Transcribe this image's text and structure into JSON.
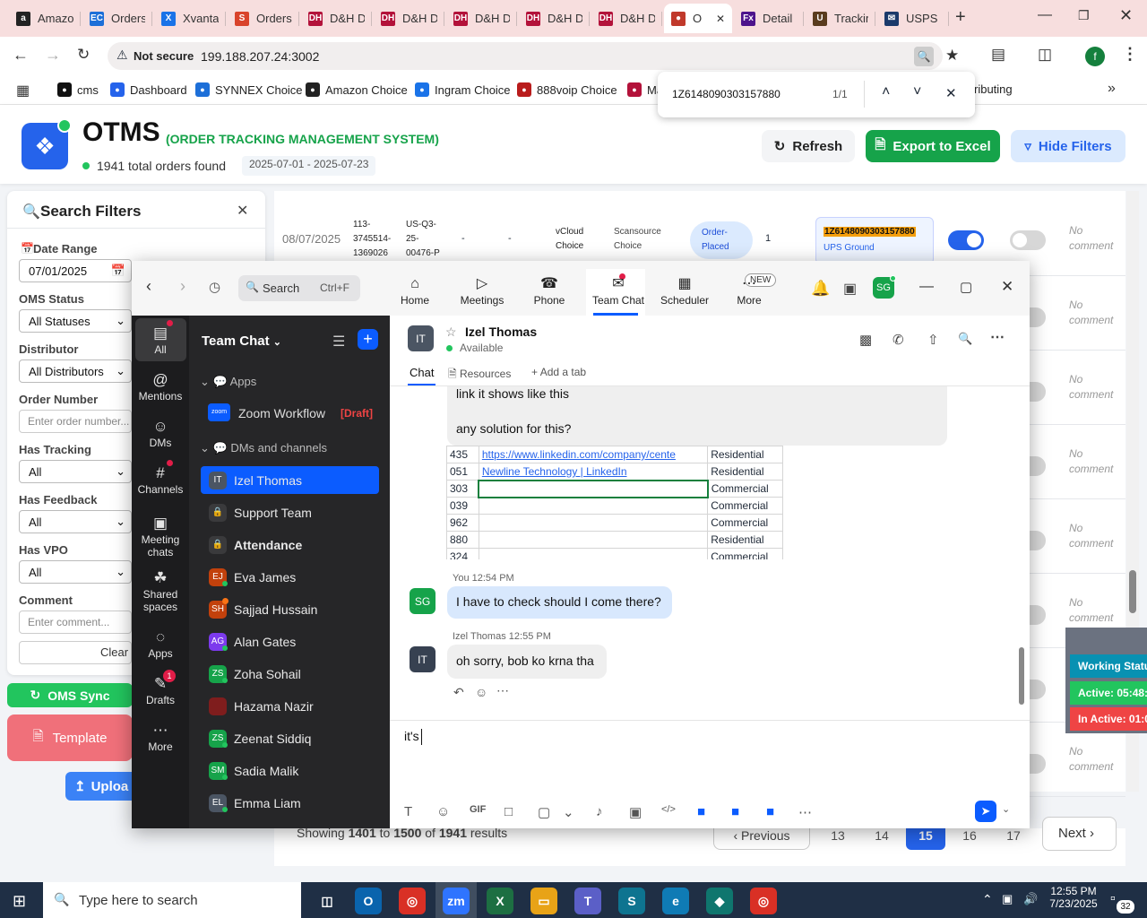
{
  "browser": {
    "tabs": [
      {
        "label": "Amazon",
        "color": "#222222",
        "glyph": "a"
      },
      {
        "label": "Orders",
        "color": "#1d6fd8",
        "glyph": "EC"
      },
      {
        "label": "Xvantage",
        "color": "#1a73e8",
        "glyph": "X"
      },
      {
        "label": "Orders",
        "color": "#d9432b",
        "glyph": "S"
      },
      {
        "label": "D&H Distributing",
        "color": "#b3123a",
        "glyph": "DH"
      },
      {
        "label": "D&H Distributing",
        "color": "#b3123a",
        "glyph": "DH"
      },
      {
        "label": "D&H Distributing",
        "color": "#b3123a",
        "glyph": "DH"
      },
      {
        "label": "D&H Distributing",
        "color": "#b3123a",
        "glyph": "DH"
      },
      {
        "label": "D&H Distributing",
        "color": "#b3123a",
        "glyph": "DH"
      },
      {
        "label": "O",
        "color": "#c0392b",
        "glyph": "●",
        "active": true
      },
      {
        "label": "Detail",
        "color": "#4d148c",
        "glyph": "Fx"
      },
      {
        "label": "Tracking",
        "color": "#5a3c1e",
        "glyph": "U"
      },
      {
        "label": "USPS",
        "color": "#1b3a6b",
        "glyph": "✉"
      }
    ],
    "url_warning": "Not secure",
    "url": "199.188.207.24:3002",
    "avatar_initial": "f",
    "bookmarks": [
      "cms",
      "Dashboard",
      "SYNNEX Choice",
      "Amazon Choice",
      "Ingram Choice",
      "888voip Choice",
      "Ma"
    ],
    "bookmark_overflow": "ributing",
    "find": {
      "query": "1Z6148090303157880",
      "count": "1/1"
    }
  },
  "app": {
    "title": "OTMS",
    "subtitle": "(ORDER TRACKING MANAGEMENT SYSTEM)",
    "orders_found": "1941 total orders found",
    "date_range": "2025-07-01 - 2025-07-23",
    "refresh": "Refresh",
    "export": "Export to Excel",
    "hide_filters": "Hide Filters"
  },
  "filters": {
    "title": "Search Filters",
    "date_label": "Date Range",
    "date_value": "07/01/2025",
    "oms_status_label": "OMS Status",
    "oms_status_value": "All Statuses",
    "distributor_label": "Distributor",
    "distributor_value": "All Distributors",
    "order_number_label": "Order Number",
    "order_number_placeholder": "Enter order number...",
    "has_tracking_label": "Has Tracking",
    "has_tracking_value": "All",
    "has_feedback_label": "Has Feedback",
    "has_feedback_value": "All",
    "has_vpo_label": "Has VPO",
    "has_vpo_value": "All",
    "comment_label": "Comment",
    "comment_placeholder": "Enter comment...",
    "clear": "Clear A",
    "oms_sync": "OMS Sync",
    "template": "Template",
    "upload": "Uploa"
  },
  "orders": {
    "row1": {
      "date": "08/07/2025",
      "order_no": [
        "113-",
        "3745514-",
        "1369026"
      ],
      "po": [
        "US-Q3-",
        "25-",
        "00476-P"
      ],
      "dash1": "-",
      "dash2": "-",
      "source": [
        "vCloud",
        "Choice"
      ],
      "distributor": [
        "Scansource",
        "Choice"
      ],
      "status": [
        "Order-",
        "Placed"
      ],
      "qty": "1",
      "tracking": "1Z6148090303157880",
      "carrier": "UPS Ground"
    },
    "no_comment": [
      "No",
      "comment"
    ],
    "pagination": {
      "showing": "Showing",
      "from": "1401",
      "to_word": "to",
      "to": "1500",
      "of_word": "of",
      "total": "1941",
      "results": "results",
      "previous": "Previous",
      "pages": [
        "13",
        "14",
        "15",
        "16",
        "17"
      ],
      "current": "15",
      "next": "Next"
    },
    "working_status": {
      "title": "Working Statu",
      "active": "Active: 05:48:",
      "inactive": "In Active: 01:0"
    }
  },
  "zoom": {
    "search_placeholder": "Search",
    "search_shortcut": "Ctrl+F",
    "nav": [
      "Home",
      "Meetings",
      "Phone",
      "Team Chat",
      "Scheduler",
      "More"
    ],
    "new_badge": "NEW",
    "user_initials": "SG",
    "rail": [
      "All",
      "Mentions",
      "DMs",
      "Channels",
      "Meeting chats",
      "Shared spaces",
      "Apps",
      "Drafts",
      "More"
    ],
    "drafts_badge": "1",
    "list_title": "Team Chat",
    "apps_section": "Apps",
    "zoom_workflow": "Zoom Workflow",
    "draft_tag": "[Draft]",
    "dms_section": "DMs and channels",
    "channels": [
      {
        "name": "Izel Thomas",
        "initials": "IT",
        "color": "#4b5563",
        "selected": true
      },
      {
        "name": "Support Team",
        "initials": "🔒",
        "color": "#3a3a3c"
      },
      {
        "name": "Attendance",
        "initials": "🔒",
        "color": "#3a3a3c",
        "bold": true
      },
      {
        "name": "Eva James",
        "initials": "EJ",
        "color": "#c2410c"
      },
      {
        "name": "Sajjad Hussain",
        "initials": "SH",
        "color": "#c2410c"
      },
      {
        "name": "Alan Gates",
        "initials": "AG",
        "color": "#7c3aed"
      },
      {
        "name": "Zoha Sohail",
        "initials": "ZS",
        "color": "#16a34a"
      },
      {
        "name": "Hazama Nazir",
        "initials": "",
        "color": "#7f1d1d"
      },
      {
        "name": "Zeenat Siddiq",
        "initials": "ZS",
        "color": "#16a34a"
      },
      {
        "name": "Sadia Malik",
        "initials": "SM",
        "color": "#16a34a"
      },
      {
        "name": "Emma Liam",
        "initials": "EL",
        "color": "#4b5563"
      }
    ],
    "chat": {
      "contact_name": "Izel Thomas",
      "contact_initials": "IT",
      "presence": "Available",
      "tabs": [
        "Chat",
        "Resources",
        "Add a tab"
      ],
      "msg_prev_line1": "link it shows like this",
      "msg_prev_line2": "any solution for this?",
      "sheet_rows": [
        {
          "id": "435",
          "link": "https://www.linkedin.com/company/cente",
          "type": "Residential"
        },
        {
          "id": "051",
          "link": "Newline Technology | LinkedIn",
          "type": "Residential"
        },
        {
          "id": "303",
          "link": "",
          "type": "Commercial"
        },
        {
          "id": "039",
          "link": "",
          "type": "Commercial"
        },
        {
          "id": "962",
          "link": "",
          "type": "Commercial"
        },
        {
          "id": "880",
          "link": "",
          "type": "Residential"
        },
        {
          "id": "324",
          "link": "",
          "type": "Commercial"
        }
      ],
      "my_sender": "You",
      "my_time": "12:54 PM",
      "my_initials": "SG",
      "my_message": "I have to check should I come there?",
      "their_sender": "Izel Thomas",
      "their_time": "12:55 PM",
      "their_message": "oh sorry, bob ko krna tha",
      "compose_text": "it's"
    }
  },
  "taskbar": {
    "search_placeholder": "Type here to search",
    "time": "12:55 PM",
    "date": "7/23/2025",
    "notif_count": "32"
  }
}
